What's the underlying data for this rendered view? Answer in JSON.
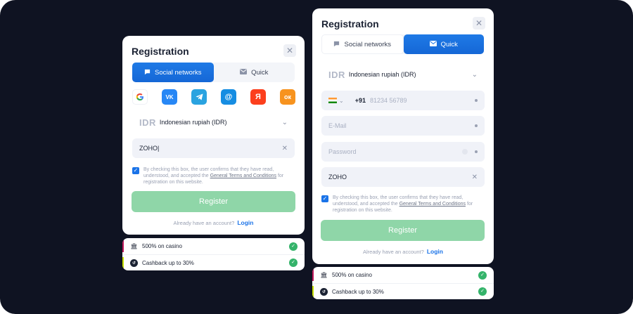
{
  "left_form": {
    "title": "Registration",
    "close_glyph": "✕",
    "tabs": [
      {
        "label": "Social networks",
        "active": true,
        "icon": "chat-icon"
      },
      {
        "label": "Quick",
        "active": false,
        "icon": "envelope-icon"
      }
    ],
    "social_buttons": [
      {
        "name": "google",
        "glyph": "G",
        "color": "#ffffff"
      },
      {
        "name": "vk",
        "glyph": "VK",
        "color": "#2787f5"
      },
      {
        "name": "telegram",
        "glyph": "➤",
        "color": "#2aa3e0"
      },
      {
        "name": "mailru",
        "glyph": "@",
        "color": "#168de2"
      },
      {
        "name": "yandex",
        "glyph": "Я",
        "color": "#fc3f1d"
      },
      {
        "name": "odnoklassniki",
        "glyph": "ок",
        "color": "#f7931e"
      }
    ],
    "currency": {
      "code": "IDR",
      "label": "Indonesian rupiah (IDR)"
    },
    "promo_value": "ZOHO",
    "terms_before": "By checking this box, the user confirms that they have read, understood, and accepted the ",
    "terms_link": "General Terms and Conditions",
    "terms_after": " for registration on this website.",
    "register_label": "Register",
    "login_prompt": "Already have an account?",
    "login_link": "Login"
  },
  "right_form": {
    "title": "Registration",
    "close_glyph": "✕",
    "tabs": [
      {
        "label": "Social networks",
        "active": false,
        "icon": "chat-icon"
      },
      {
        "label": "Quick",
        "active": true,
        "icon": "envelope-icon"
      }
    ],
    "currency": {
      "code": "IDR",
      "label": "Indonesian rupiah (IDR)"
    },
    "phone": {
      "prefix": "+91",
      "placeholder": "81234 56789"
    },
    "email_placeholder": "E-Mail",
    "password_placeholder": "Password",
    "promo_value": "ZOHO",
    "terms_before": "By checking this box, the user confirms that they have read, understood, and accepted the ",
    "terms_link": "General Terms and Conditions",
    "terms_after": " for registration on this website.",
    "register_label": "Register",
    "login_prompt": "Already have an account?",
    "login_link": "Login"
  },
  "bonuses": [
    {
      "label": "500% on casino",
      "icon": "casino-icon",
      "strip_color": "#c2185b"
    },
    {
      "label": "Cashback up to 30%",
      "icon": "cashback-icon",
      "strip_color": "#c7e000"
    }
  ],
  "colors": {
    "background": "#0f1322",
    "accent": "#1a73e8",
    "register_button": "#8fd6a8",
    "success": "#34b36a"
  }
}
